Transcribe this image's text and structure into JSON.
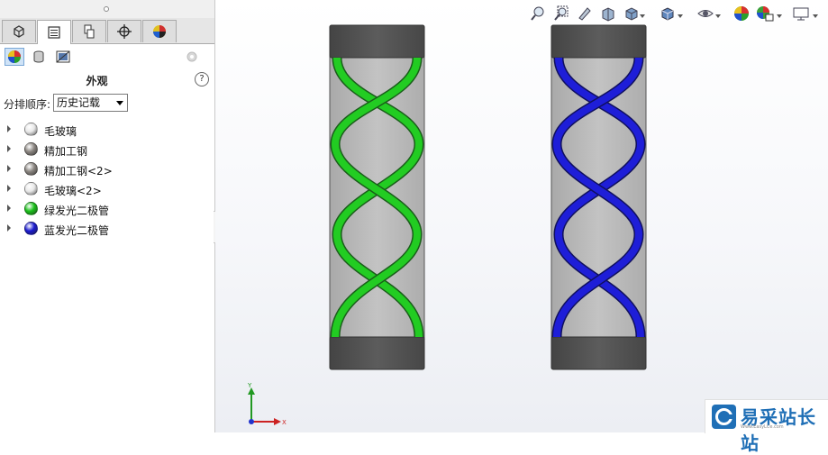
{
  "panel": {
    "title": "外观",
    "help_label": "?",
    "sort_label": "分排顺序:",
    "sort_value": "历史记载"
  },
  "tabs": [
    {
      "icon": "feature-manager-icon",
      "active": false
    },
    {
      "icon": "property-manager-icon",
      "active": true
    },
    {
      "icon": "configuration-manager-icon",
      "active": false
    },
    {
      "icon": "dimxpert-manager-icon",
      "active": false
    },
    {
      "icon": "display-manager-icon",
      "active": false
    }
  ],
  "subicons": [
    "appearances-icon",
    "decals-icon",
    "scenes-icon",
    "settings-gear-icon"
  ],
  "appearances": [
    {
      "label": "毛玻璃",
      "color": "#e8e8e8"
    },
    {
      "label": "精加工钢",
      "color": "#8a8580"
    },
    {
      "label": "精加工钢<2>",
      "color": "#8a8580"
    },
    {
      "label": "毛玻璃<2>",
      "color": "#e8e8e8"
    },
    {
      "label": "绿发光二极管",
      "color": "#19c019"
    },
    {
      "label": "蓝发光二极管",
      "color": "#1a1ad0"
    }
  ],
  "hud_icons": [
    "zoom-to-fit-icon",
    "zoom-to-area-icon",
    "previous-view-icon",
    "section-view-icon",
    "view-orientation-icon",
    "display-style-icon",
    "hide-show-icon",
    "edit-appearance-icon",
    "apply-scene-icon",
    "view-settings-icon"
  ],
  "triad": {
    "x_label": "X",
    "y_label": "Y"
  },
  "watermark": {
    "text": "易采站长站",
    "sub": "Www.EasyLCe.com"
  },
  "colors": {
    "green_led": "#22cc22",
    "blue_led": "#1e1ed8",
    "steel": "#555555",
    "glass": "#b8b8b8"
  }
}
